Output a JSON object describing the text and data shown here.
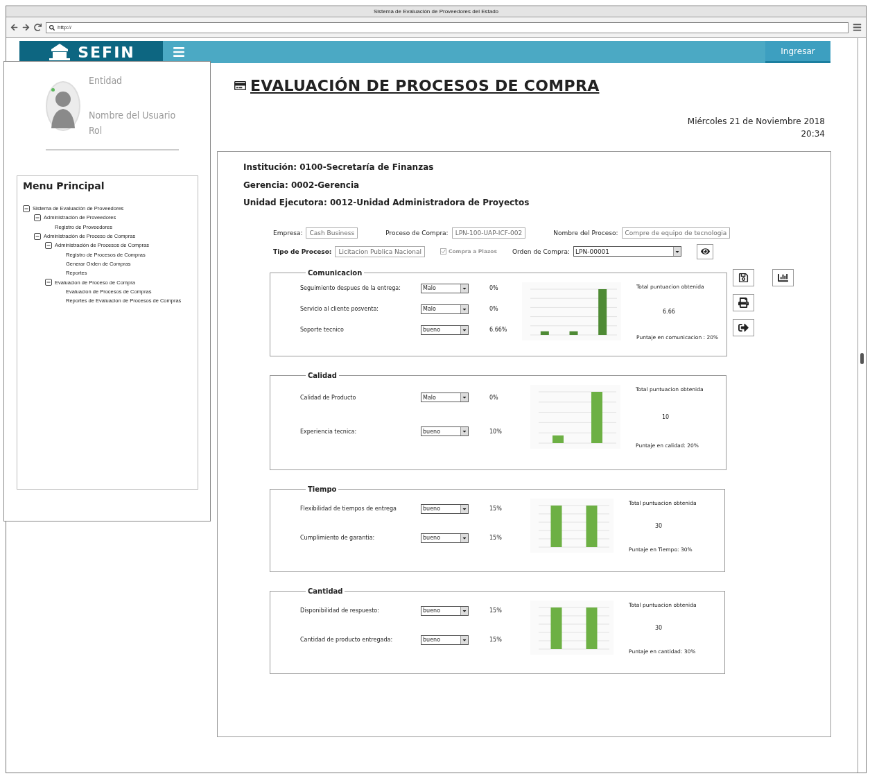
{
  "window": {
    "title": "Sistema de Evaluación de Proveedores del Estado"
  },
  "browser": {
    "url": "http://"
  },
  "header": {
    "logo": "SEFIN",
    "login_button": "Ingresar"
  },
  "user": {
    "entity": "Entidad",
    "name": "Nombre del Usuario",
    "role": "Rol",
    "online": true
  },
  "menu": {
    "title": "Menu Principal",
    "items": [
      {
        "label": "Sistema de Evaluación de Proveedores",
        "expanded": true,
        "children": [
          {
            "label": "Administración de Proveedores",
            "expanded": true,
            "children": [
              {
                "label": "Registro de Proveedores"
              }
            ]
          },
          {
            "label": "Administración de Proceso de Compras",
            "expanded": true,
            "children": [
              {
                "label": "Administración de Procesos de Compras",
                "expanded": true,
                "children": [
                  {
                    "label": "Registro de Procesos de Compras"
                  },
                  {
                    "label": "Generar Orden de Compras"
                  },
                  {
                    "label": "Reportes"
                  }
                ]
              },
              {
                "label": "Evaluacion de Proceso de Compra",
                "expanded": true,
                "children": [
                  {
                    "label": "Evaluacion de Procesos de Compras"
                  },
                  {
                    "label": "Reportes de Evaluacion de Procesos de Compras"
                  }
                ]
              }
            ]
          }
        ]
      }
    ]
  },
  "page": {
    "title": "EVALUACIÓN DE PROCESOS DE COMPRA",
    "date": "Miércoles 21 de Noviembre 2018",
    "time": "20:34"
  },
  "info": [
    "Institución: 0100-Secretaría de Finanzas",
    "Gerencia: 0002-Gerencia",
    "Unidad Ejecutora: 0012-Unidad Administradora de Proyectos"
  ],
  "form": {
    "rows": [
      [
        {
          "kind": "text",
          "label": "Empresa:",
          "value": "Cash Business"
        },
        {
          "kind": "text",
          "label": "Proceso de Compra:",
          "value": "LPN-100-UAP-ICF-002"
        },
        {
          "kind": "text",
          "label": "Nombre del Proceso:",
          "value": "Compre de equipo de tecnologia"
        }
      ],
      [
        {
          "kind": "text",
          "label": "Tipo de Proceso:",
          "value": "Licitacion Publica Nacional",
          "bold": true
        },
        {
          "kind": "checkbox",
          "label": "Compra a Plazos",
          "checked": true,
          "disabled": true
        },
        {
          "kind": "select",
          "label": "Orden de Compra:",
          "value": "LPN-00001"
        },
        {
          "kind": "view"
        }
      ]
    ]
  },
  "sections": [
    {
      "title": "Comunicacion",
      "criteria": [
        {
          "label": "Seguimiento despues de la entrega:",
          "value": "Malo",
          "percent": "0%"
        },
        {
          "label": "Servicio al cliente posventa:",
          "value": "Malo",
          "percent": "0%"
        },
        {
          "label": "Soporte tecnico",
          "value": "bueno",
          "percent": "6.66%"
        }
      ],
      "total_label": "Total puntuacion obtenida",
      "total": "6.66",
      "weight": "Puntaje en comunicacion : 20%"
    },
    {
      "title": "Calidad",
      "criteria": [
        {
          "label": "Calidad de Producto",
          "value": "Malo",
          "percent": "0%"
        },
        {
          "label": "Experiencia tecnica:",
          "value": "bueno",
          "percent": "10%"
        }
      ],
      "total_label": "Total puntuacion obtenida",
      "total": "10",
      "weight": "Puntaje en calidad: 20%"
    },
    {
      "title": "Tiempo",
      "criteria": [
        {
          "label": "Flexibilidad de tiempos de entrega",
          "value": "bueno",
          "percent": "15%"
        },
        {
          "label": "Cumplimiento de garantia:",
          "value": "bueno",
          "percent": "15%"
        }
      ],
      "total_label": "Total puntuacion obtenida",
      "total": "30",
      "weight": "Puntaje en Tiempo: 30%"
    },
    {
      "title": "Cantidad",
      "criteria": [
        {
          "label": "Disponibilidad de respuesto:",
          "value": "bueno",
          "percent": "15%"
        },
        {
          "label": "Cantidad de producto entregada:",
          "value": "bueno",
          "percent": "15%"
        }
      ],
      "total_label": "Total puntuacion obtenida",
      "total": "30",
      "weight": "Puntaje en cantidad: 30%"
    }
  ]
}
